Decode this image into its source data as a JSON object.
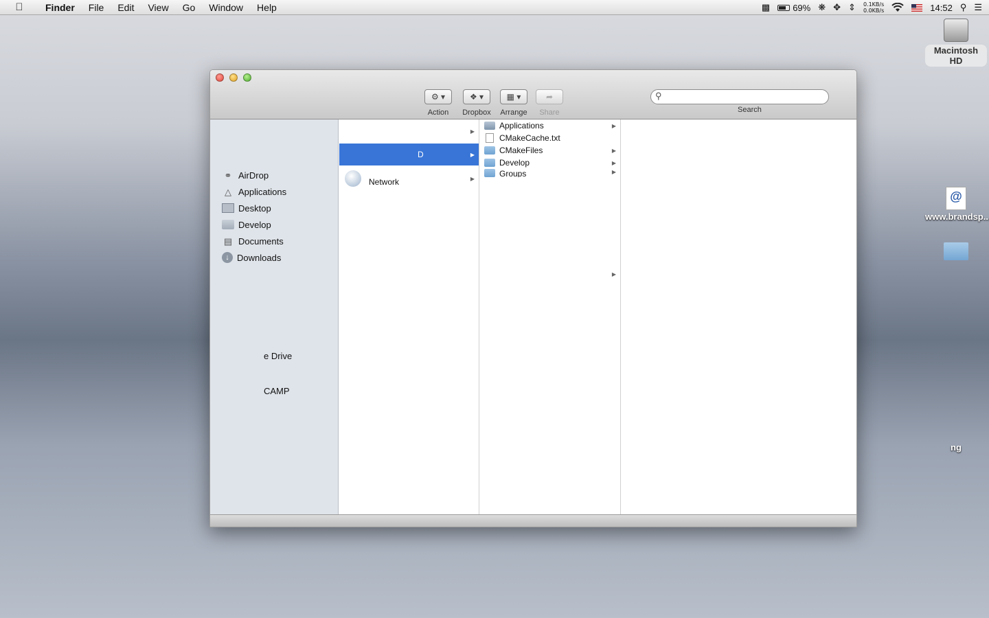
{
  "menubar": {
    "app_name": "Finder",
    "items": [
      "File",
      "Edit",
      "View",
      "Go",
      "Window",
      "Help"
    ],
    "battery_percent": "69%",
    "battery_level": 0.69,
    "net_up": "0.1KB/s",
    "net_down": "0.0KB/s",
    "clock": "14:52"
  },
  "desktop": {
    "hd_label": "Macintosh HD",
    "weblink_label": "www.brandsp...et/",
    "partial_label": "ng"
  },
  "toolbar": {
    "action_label": "Action",
    "dropbox_label": "Dropbox",
    "arrange_label": "Arrange",
    "share_label": "Share",
    "search_label": "Search",
    "search_value": ""
  },
  "sidebar": {
    "items": [
      {
        "label": "AirDrop",
        "icon": "airdrop-icon"
      },
      {
        "label": "Applications",
        "icon": "applications-icon"
      },
      {
        "label": "Desktop",
        "icon": "desktop-icon"
      },
      {
        "label": "Develop",
        "icon": "folder-icon"
      },
      {
        "label": "Documents",
        "icon": "documents-icon"
      },
      {
        "label": "Downloads",
        "icon": "downloads-icon"
      }
    ],
    "partial_items": [
      "e Drive",
      "CAMP"
    ]
  },
  "columns": {
    "col1": {
      "selected_label": "D",
      "network_label": "Network"
    },
    "col2": {
      "items": [
        "Applications",
        "CMakeCache.txt",
        "CMakeFiles",
        "Develop",
        "Groups"
      ]
    }
  },
  "colors": {
    "selection": "#3875d7",
    "sidebar_bg": "#dfe4ea"
  }
}
